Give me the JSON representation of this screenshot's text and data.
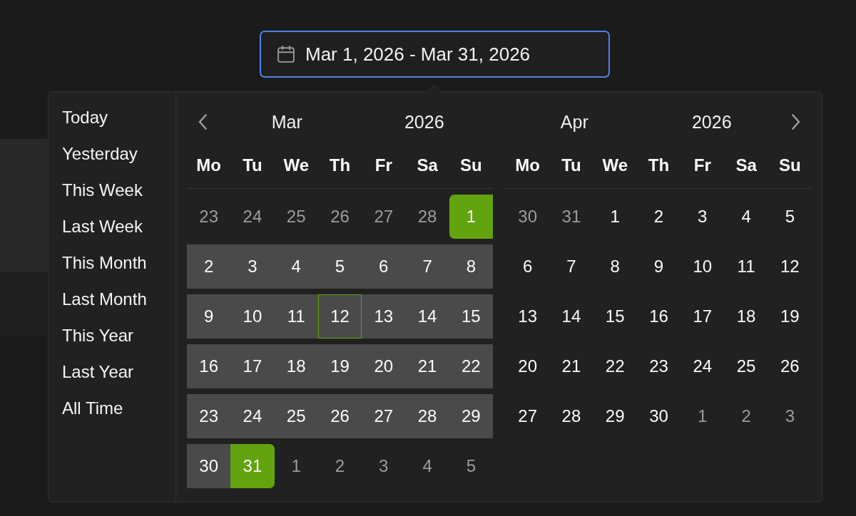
{
  "date_range_field": {
    "value": "Mar 1, 2026 - Mar 31, 2026",
    "focused": true
  },
  "presets": [
    {
      "label": "Today",
      "selected": false
    },
    {
      "label": "Yesterday",
      "selected": false
    },
    {
      "label": "This Week",
      "selected": false
    },
    {
      "label": "Last Week",
      "selected": false
    },
    {
      "label": "This Month",
      "selected": false
    },
    {
      "label": "Last Month",
      "selected": false
    },
    {
      "label": "This Year",
      "selected": false
    },
    {
      "label": "Last Year",
      "selected": false
    },
    {
      "label": "All Time",
      "selected": false
    }
  ],
  "calendars": [
    {
      "kind": "previous",
      "month": "Mar",
      "year": "2026",
      "weekdays": [
        "Mo",
        "Tu",
        "We",
        "Th",
        "Fr",
        "Sa",
        "Su"
      ],
      "weeks": [
        [
          {
            "day": "23",
            "outside": true,
            "in_range": false,
            "selected": false,
            "today": false
          },
          {
            "day": "24",
            "outside": true,
            "in_range": false,
            "selected": false,
            "today": false
          },
          {
            "day": "25",
            "outside": true,
            "in_range": false,
            "selected": false,
            "today": false
          },
          {
            "day": "26",
            "outside": true,
            "in_range": false,
            "selected": false,
            "today": false
          },
          {
            "day": "27",
            "outside": true,
            "in_range": false,
            "selected": false,
            "today": false
          },
          {
            "day": "28",
            "outside": true,
            "in_range": false,
            "selected": false,
            "today": false
          },
          {
            "day": "1",
            "outside": false,
            "in_range": true,
            "selected": true,
            "today": false
          }
        ],
        [
          {
            "day": "2",
            "outside": false,
            "in_range": true,
            "selected": false,
            "today": false
          },
          {
            "day": "3",
            "outside": false,
            "in_range": true,
            "selected": false,
            "today": false
          },
          {
            "day": "4",
            "outside": false,
            "in_range": true,
            "selected": false,
            "today": false
          },
          {
            "day": "5",
            "outside": false,
            "in_range": true,
            "selected": false,
            "today": false
          },
          {
            "day": "6",
            "outside": false,
            "in_range": true,
            "selected": false,
            "today": false
          },
          {
            "day": "7",
            "outside": false,
            "in_range": true,
            "selected": false,
            "today": false
          },
          {
            "day": "8",
            "outside": false,
            "in_range": true,
            "selected": false,
            "today": false
          }
        ],
        [
          {
            "day": "9",
            "outside": false,
            "in_range": true,
            "selected": false,
            "today": false
          },
          {
            "day": "10",
            "outside": false,
            "in_range": true,
            "selected": false,
            "today": false
          },
          {
            "day": "11",
            "outside": false,
            "in_range": true,
            "selected": false,
            "today": false
          },
          {
            "day": "12",
            "outside": false,
            "in_range": true,
            "selected": false,
            "today": true
          },
          {
            "day": "13",
            "outside": false,
            "in_range": true,
            "selected": false,
            "today": false
          },
          {
            "day": "14",
            "outside": false,
            "in_range": true,
            "selected": false,
            "today": false
          },
          {
            "day": "15",
            "outside": false,
            "in_range": true,
            "selected": false,
            "today": false
          }
        ],
        [
          {
            "day": "16",
            "outside": false,
            "in_range": true,
            "selected": false,
            "today": false
          },
          {
            "day": "17",
            "outside": false,
            "in_range": true,
            "selected": false,
            "today": false
          },
          {
            "day": "18",
            "outside": false,
            "in_range": true,
            "selected": false,
            "today": false
          },
          {
            "day": "19",
            "outside": false,
            "in_range": true,
            "selected": false,
            "today": false
          },
          {
            "day": "20",
            "outside": false,
            "in_range": true,
            "selected": false,
            "today": false
          },
          {
            "day": "21",
            "outside": false,
            "in_range": true,
            "selected": false,
            "today": false
          },
          {
            "day": "22",
            "outside": false,
            "in_range": true,
            "selected": false,
            "today": false
          }
        ],
        [
          {
            "day": "23",
            "outside": false,
            "in_range": true,
            "selected": false,
            "today": false
          },
          {
            "day": "24",
            "outside": false,
            "in_range": true,
            "selected": false,
            "today": false
          },
          {
            "day": "25",
            "outside": false,
            "in_range": true,
            "selected": false,
            "today": false
          },
          {
            "day": "26",
            "outside": false,
            "in_range": true,
            "selected": false,
            "today": false
          },
          {
            "day": "27",
            "outside": false,
            "in_range": true,
            "selected": false,
            "today": false
          },
          {
            "day": "28",
            "outside": false,
            "in_range": true,
            "selected": false,
            "today": false
          },
          {
            "day": "29",
            "outside": false,
            "in_range": true,
            "selected": false,
            "today": false
          }
        ],
        [
          {
            "day": "30",
            "outside": false,
            "in_range": true,
            "selected": false,
            "today": false
          },
          {
            "day": "31",
            "outside": false,
            "in_range": true,
            "selected": true,
            "today": false
          },
          {
            "day": "1",
            "outside": true,
            "in_range": false,
            "selected": false,
            "today": false
          },
          {
            "day": "2",
            "outside": true,
            "in_range": false,
            "selected": false,
            "today": false
          },
          {
            "day": "3",
            "outside": true,
            "in_range": false,
            "selected": false,
            "today": false
          },
          {
            "day": "4",
            "outside": true,
            "in_range": false,
            "selected": false,
            "today": false
          },
          {
            "day": "5",
            "outside": true,
            "in_range": false,
            "selected": false,
            "today": false
          }
        ]
      ]
    },
    {
      "kind": "next",
      "month": "Apr",
      "year": "2026",
      "weekdays": [
        "Mo",
        "Tu",
        "We",
        "Th",
        "Fr",
        "Sa",
        "Su"
      ],
      "weeks": [
        [
          {
            "day": "30",
            "outside": true,
            "in_range": false,
            "selected": false,
            "today": false
          },
          {
            "day": "31",
            "outside": true,
            "in_range": false,
            "selected": false,
            "today": false
          },
          {
            "day": "1",
            "outside": false,
            "in_range": false,
            "selected": false,
            "today": false
          },
          {
            "day": "2",
            "outside": false,
            "in_range": false,
            "selected": false,
            "today": false
          },
          {
            "day": "3",
            "outside": false,
            "in_range": false,
            "selected": false,
            "today": false
          },
          {
            "day": "4",
            "outside": false,
            "in_range": false,
            "selected": false,
            "today": false
          },
          {
            "day": "5",
            "outside": false,
            "in_range": false,
            "selected": false,
            "today": false
          }
        ],
        [
          {
            "day": "6",
            "outside": false,
            "in_range": false,
            "selected": false,
            "today": false
          },
          {
            "day": "7",
            "outside": false,
            "in_range": false,
            "selected": false,
            "today": false
          },
          {
            "day": "8",
            "outside": false,
            "in_range": false,
            "selected": false,
            "today": false
          },
          {
            "day": "9",
            "outside": false,
            "in_range": false,
            "selected": false,
            "today": false
          },
          {
            "day": "10",
            "outside": false,
            "in_range": false,
            "selected": false,
            "today": false
          },
          {
            "day": "11",
            "outside": false,
            "in_range": false,
            "selected": false,
            "today": false
          },
          {
            "day": "12",
            "outside": false,
            "in_range": false,
            "selected": false,
            "today": false
          }
        ],
        [
          {
            "day": "13",
            "outside": false,
            "in_range": false,
            "selected": false,
            "today": false
          },
          {
            "day": "14",
            "outside": false,
            "in_range": false,
            "selected": false,
            "today": false
          },
          {
            "day": "15",
            "outside": false,
            "in_range": false,
            "selected": false,
            "today": false
          },
          {
            "day": "16",
            "outside": false,
            "in_range": false,
            "selected": false,
            "today": false
          },
          {
            "day": "17",
            "outside": false,
            "in_range": false,
            "selected": false,
            "today": false
          },
          {
            "day": "18",
            "outside": false,
            "in_range": false,
            "selected": false,
            "today": false
          },
          {
            "day": "19",
            "outside": false,
            "in_range": false,
            "selected": false,
            "today": false
          }
        ],
        [
          {
            "day": "20",
            "outside": false,
            "in_range": false,
            "selected": false,
            "today": false
          },
          {
            "day": "21",
            "outside": false,
            "in_range": false,
            "selected": false,
            "today": false
          },
          {
            "day": "22",
            "outside": false,
            "in_range": false,
            "selected": false,
            "today": false
          },
          {
            "day": "23",
            "outside": false,
            "in_range": false,
            "selected": false,
            "today": false
          },
          {
            "day": "24",
            "outside": false,
            "in_range": false,
            "selected": false,
            "today": false
          },
          {
            "day": "25",
            "outside": false,
            "in_range": false,
            "selected": false,
            "today": false
          },
          {
            "day": "26",
            "outside": false,
            "in_range": false,
            "selected": false,
            "today": false
          }
        ],
        [
          {
            "day": "27",
            "outside": false,
            "in_range": false,
            "selected": false,
            "today": false
          },
          {
            "day": "28",
            "outside": false,
            "in_range": false,
            "selected": false,
            "today": false
          },
          {
            "day": "29",
            "outside": false,
            "in_range": false,
            "selected": false,
            "today": false
          },
          {
            "day": "30",
            "outside": false,
            "in_range": false,
            "selected": false,
            "today": false
          },
          {
            "day": "1",
            "outside": true,
            "in_range": false,
            "selected": false,
            "today": false
          },
          {
            "day": "2",
            "outside": true,
            "in_range": false,
            "selected": false,
            "today": false
          },
          {
            "day": "3",
            "outside": true,
            "in_range": false,
            "selected": false,
            "today": false
          }
        ]
      ]
    }
  ]
}
